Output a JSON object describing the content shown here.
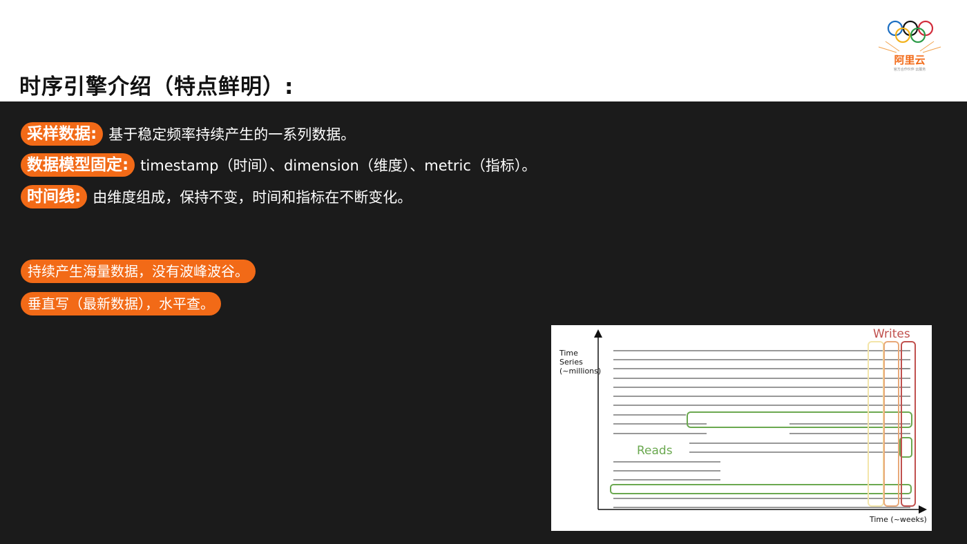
{
  "title": "时序引擎介绍（特点鲜明）:",
  "logo": {
    "text": "阿里云",
    "subtext": "官方合作伙伴 云服务"
  },
  "points": [
    {
      "label": "采样数据:",
      "text": "基于稳定频率持续产生的一系列数据。"
    },
    {
      "label": "数据模型固定:",
      "text": "timestamp（时间）、dimension（维度）、metric（指标）。"
    },
    {
      "label": "时间线:",
      "text": "由维度组成，保持不变，时间和指标在不断变化。"
    }
  ],
  "pills": [
    "持续产生海量数据，没有波峰波谷。",
    "垂直写（最新数据），水平查。"
  ],
  "diagram": {
    "y_label_lines": [
      "Time",
      "Series",
      "(~millions)"
    ],
    "x_label": "Time (~weeks)",
    "reads_label": "Reads",
    "writes_label": "Writes",
    "colors": {
      "reads": "#6aa84f",
      "writes": "#c0504d",
      "accent": "#e8a878",
      "pale": "#f3e5a9"
    }
  }
}
